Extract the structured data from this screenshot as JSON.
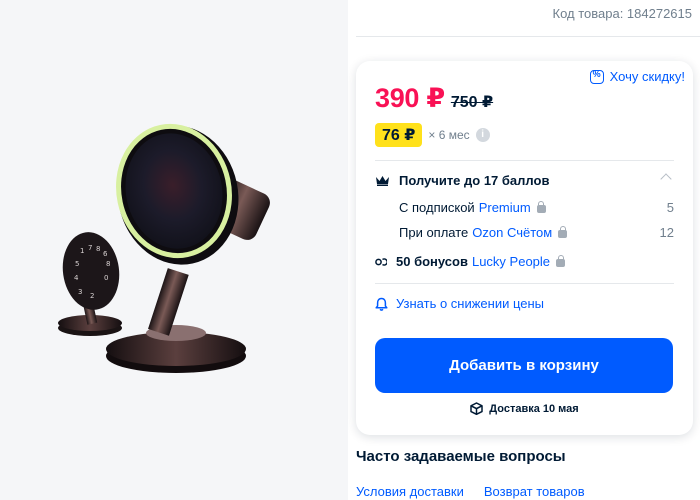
{
  "product": {
    "sku_text": "Код товара: 184272615"
  },
  "pricing": {
    "price": "390 ₽",
    "old_price": "750 ₽",
    "want_discount": "Хочу скидку!",
    "installment_amount": "76 ₽",
    "installment_term": "× 6 мес",
    "info_icon": "info-icon"
  },
  "points": {
    "header": "Получите до 17 баллов",
    "rows": [
      {
        "label": "С подпиской",
        "link": "Premium",
        "value": "5"
      },
      {
        "label": "При оплате",
        "link": "Ozon Счётом",
        "value": "12"
      }
    ]
  },
  "bonus": {
    "bold": "50 бонусов",
    "link": "Lucky People"
  },
  "notify_text": "Узнать о снижении цены",
  "cart_button": "Добавить в корзину",
  "delivery_text": "Доставка 10 мая",
  "faq": {
    "title": "Часто задаваемые вопросы",
    "links": [
      "Условия доставки",
      "Возврат товаров"
    ]
  },
  "colors": {
    "accent": "#005bff",
    "price": "#f91155",
    "installment_badge": "#ffe11b"
  }
}
